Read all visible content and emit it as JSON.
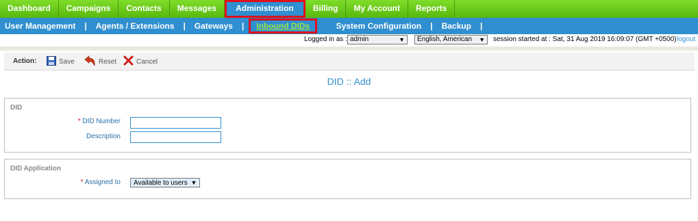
{
  "topnav": {
    "items": [
      "Dashboard",
      "Campaigns",
      "Contacts",
      "Messages",
      "Administration",
      "Billing",
      "My Account",
      "Reports"
    ],
    "active": "Administration"
  },
  "subnav": {
    "items": [
      "User Management",
      "Agents / Extensions",
      "Gateways",
      "Inbound DIDs",
      "System Configuration",
      "Backup"
    ],
    "active": "Inbound DIDs"
  },
  "session": {
    "logged_in_label": "Logged in as :",
    "user": "admin",
    "language": "English, American",
    "session_info": "session started at : Sat, 31 Aug 2019 16:09:07 (GMT +0500)",
    "logout": "logout"
  },
  "actionbar": {
    "label": "Action:",
    "save": "Save",
    "reset": "Reset",
    "cancel": "Cancel"
  },
  "page": {
    "title": "DID :: Add"
  },
  "did_section": {
    "legend": "DID",
    "did_number_label": "DID Number",
    "did_number_value": "",
    "description_label": "Description",
    "description_value": ""
  },
  "application_section": {
    "legend": "DID Application",
    "assigned_to_label": "Assigned to",
    "assigned_to_value": "Available to users"
  },
  "colors": {
    "green_nav": "#6bc81c",
    "blue_nav": "#2f8fd0",
    "highlight_red": "#e0101a",
    "active_sub_text": "#9de24a"
  }
}
